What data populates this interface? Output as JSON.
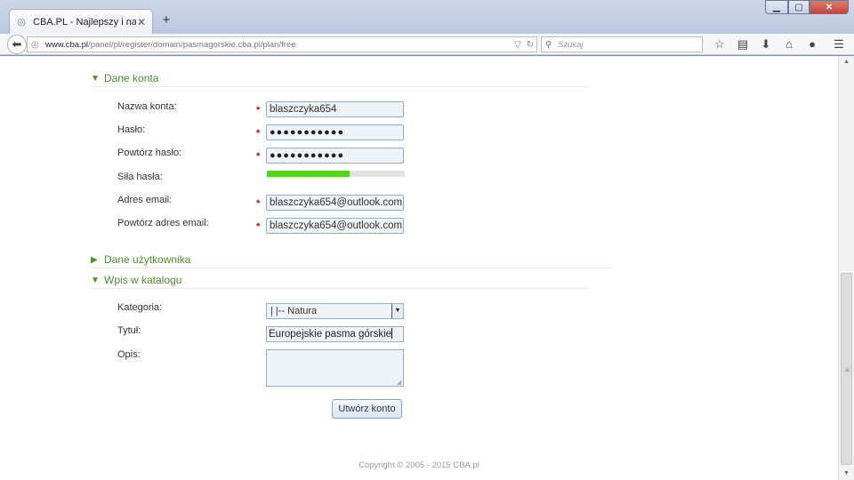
{
  "browser": {
    "tab_title": "CBA.PL - Najlepszy i najpo...",
    "tab_close": "✕",
    "new_tab": "+",
    "window_controls": {
      "minimize": "▁",
      "maximize": "▢",
      "close": "✕"
    },
    "url_host": "www.cba.pl",
    "url_path": "/panel/pl/register/domain/pasmagorskie.cba.pl/plan/free",
    "search_placeholder": "Szukaj",
    "icons": [
      "star-icon",
      "reading-list-icon",
      "download-icon",
      "home-icon",
      "chat-icon",
      "menu-icon"
    ]
  },
  "form": {
    "account_section": {
      "title": "Dane konta",
      "toggle": "▼",
      "labels": {
        "account_name": "Nazwa konta:",
        "password": "Hasło:",
        "password_repeat": "Powtórz hasło:",
        "strength": "Siła hasła:",
        "email": "Adres email:",
        "email_repeat": "Powtórz adres email:"
      },
      "values": {
        "account_name": "blaszczyka654",
        "password": "●●●●●●●●●●●",
        "password_repeat": "●●●●●●●●●●●",
        "email": "blaszczyka654@outlook.com",
        "email_repeat": "blaszczyka654@outlook.com"
      },
      "strength_fraction": 0.6,
      "required_mark": "*"
    },
    "user_section": {
      "title": "Dane użytkownika",
      "toggle": "▶"
    },
    "catalog_section": {
      "title": "Wpis w katalogu",
      "toggle": "▼",
      "labels": {
        "category": "Kategoria:",
        "title": "Tytuł:",
        "description": "Opis:"
      },
      "values": {
        "category": "|    |-- Natura",
        "title": "Europejskie pasma górskie",
        "description": ""
      }
    },
    "submit_label": "Utwórz konto"
  },
  "footer": {
    "copyright": "Copyright © 2005 - 2015 CBA.pl"
  },
  "colors": {
    "section_green": "#4e8f2a",
    "strength_green": "#4fd616",
    "required_red": "#d40000"
  }
}
